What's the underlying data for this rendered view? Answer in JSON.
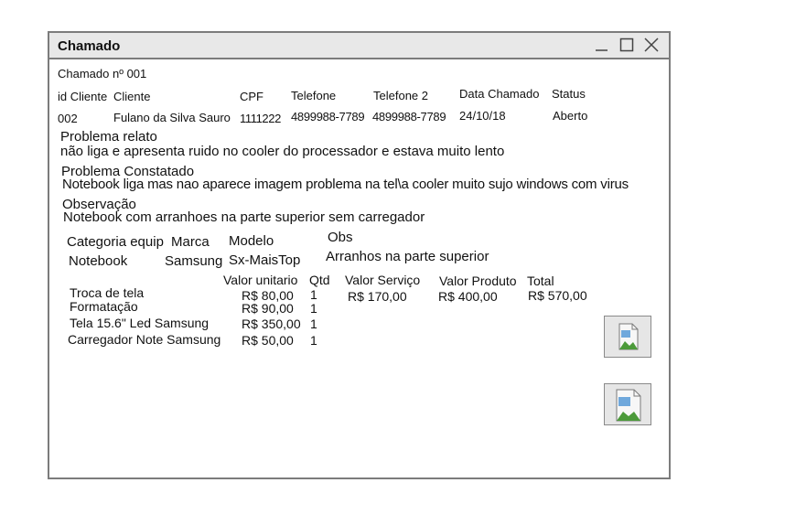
{
  "window": {
    "title": "Chamado"
  },
  "ticket": {
    "number_label": "Chamado nº 001"
  },
  "customer": {
    "headers": [
      "id Cliente",
      "Cliente",
      "CPF",
      "Telefone",
      "Telefone 2",
      "Data Chamado",
      "Status"
    ],
    "values": [
      "002",
      "Fulano da Silva Sauro",
      "1111222",
      "4899988-7789",
      "4899988-7789",
      "24/10/18",
      "Aberto"
    ]
  },
  "problem_report": {
    "label": "Problema relato",
    "text": "não liga e apresenta ruido no cooler do processador e estava muito lento"
  },
  "problem_found": {
    "label": "Problema Constatado",
    "text": "Notebook liga mas nao aparece imagem problema na tel\\a cooler muito sujo windows com virus"
  },
  "observation": {
    "label": "Observação",
    "text": "Notebook com arranhoes na parte superior sem carregador"
  },
  "equipment": {
    "headers": [
      "Categoria equip",
      "Marca",
      "Modelo",
      "Obs"
    ],
    "values": [
      "Notebook",
      "Samsung",
      "Sx-MaisTop",
      "Arranhos na parte superior"
    ]
  },
  "items": {
    "headers": [
      "Valor unitario",
      "Qtd",
      "Valor Serviço",
      "Valor Produto",
      "Total"
    ],
    "rows": [
      {
        "name": "Troca de tela",
        "unit": "R$ 80,00",
        "qty": "1"
      },
      {
        "name": "Formatação",
        "unit": "R$ 90,00",
        "qty": "1"
      },
      {
        "name": "Tela 15.6\" Led Samsung",
        "unit": "R$ 350,00",
        "qty": "1"
      },
      {
        "name": "Carregador Note Samsung",
        "unit": "R$ 50,00",
        "qty": "1"
      }
    ],
    "totals": {
      "service": "R$ 170,00",
      "product": "R$ 400,00",
      "total": "R$ 570,00"
    }
  },
  "icons": {
    "minimize": "minimize-icon",
    "maximize": "maximize-icon",
    "close": "close-icon",
    "image": "broken-image-icon"
  }
}
